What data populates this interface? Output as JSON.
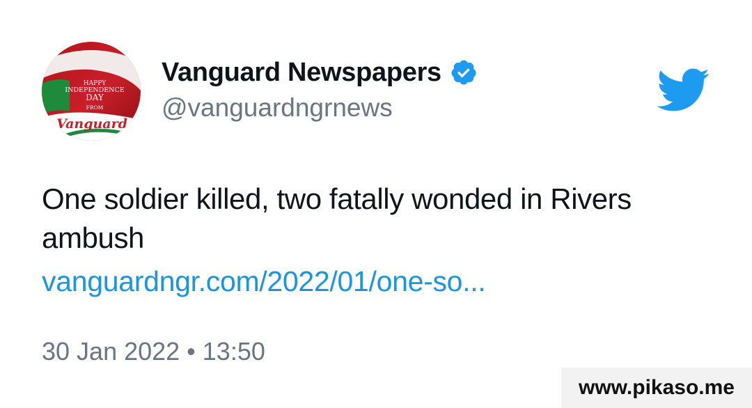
{
  "account": {
    "display_name": "Vanguard Newspapers",
    "handle": "@vanguardngrnews",
    "verified": true,
    "avatar": {
      "line1": "HAPPY",
      "line2": "INDEPENDENCE",
      "line3": "DAY",
      "line4": "FROM",
      "brand": "Vanguard"
    }
  },
  "tweet": {
    "text": "One soldier killed, two fatally wonded in Rivers ambush",
    "link": "vanguardngr.com/2022/01/one-so...",
    "timestamp": "30 Jan 2022 • 13:50"
  },
  "icons": {
    "brand_icon": "twitter-bird-icon",
    "verified_icon": "verified-badge-icon"
  },
  "colors": {
    "link": "#1b95e0",
    "twitter_blue": "#1d9bf0",
    "secondary_text": "#687684",
    "primary_text": "#0f1419"
  },
  "watermark": {
    "text": "www.pikaso.me"
  }
}
